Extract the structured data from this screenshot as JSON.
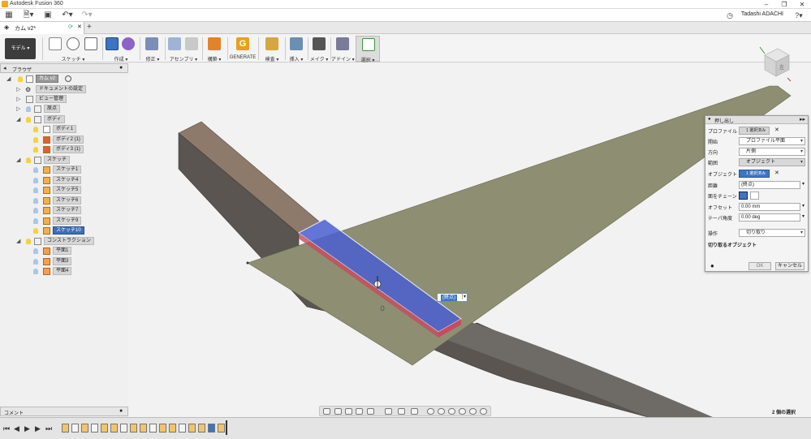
{
  "app": {
    "title": "Autodesk Fusion 360",
    "user": "Tadashi ADACHI"
  },
  "document_tab": {
    "label": "カム v2*"
  },
  "ribbon": {
    "workspace": "モデル ▾",
    "groups": [
      "スケッチ ▾",
      "作成 ▾",
      "修正 ▾",
      "アセンブリ ▾",
      "構築 ▾",
      "GENERATE",
      "検査 ▾",
      "挿入 ▾",
      "メイク ▾",
      "アドイン ▾",
      "選択 ▾"
    ]
  },
  "browser": {
    "header": "ブラウザ",
    "root": "カム v2",
    "nodes": [
      {
        "label": "ドキュメントの設定"
      },
      {
        "label": "ビュー管理"
      },
      {
        "label": "原点"
      },
      {
        "label": "ボディ"
      },
      {
        "label": "ボディ1"
      },
      {
        "label": "ボディ2 (1)"
      },
      {
        "label": "ボディ3 (1)"
      },
      {
        "label": "スケッチ"
      },
      {
        "label": "スケッチ1"
      },
      {
        "label": "スケッチ4"
      },
      {
        "label": "スケッチ5"
      },
      {
        "label": "スケッチ6"
      },
      {
        "label": "スケッチ7"
      },
      {
        "label": "スケッチ9"
      },
      {
        "label": "スケッチ10"
      },
      {
        "label": "コンストラクション"
      },
      {
        "label": "平面1"
      },
      {
        "label": "平面3"
      },
      {
        "label": "平面4"
      }
    ]
  },
  "comments": {
    "header": "コメント"
  },
  "dialog": {
    "title": "押し出し",
    "rows": [
      {
        "label": "プロファイル",
        "value": "1 選択済み"
      },
      {
        "label": "開始",
        "value": "プロファイル平面"
      },
      {
        "label": "方向",
        "value": "片側"
      },
      {
        "label": "範囲",
        "value": "オブジェクト"
      },
      {
        "label": "オブジェクト",
        "value": "1 選択済み"
      },
      {
        "label": "距離",
        "value": "(終点)"
      },
      {
        "label": "面をチェーン",
        "value": ""
      },
      {
        "label": "オフセット",
        "value": "0.00 mm"
      },
      {
        "label": "テーパ角度",
        "value": "0.00 deg"
      },
      {
        "label": "操作",
        "value": "切り取り"
      }
    ],
    "section": "切り取るオブジェクト",
    "ok": "OK",
    "cancel": "キャンセル"
  },
  "viewport": {
    "distance_field": "(終点)"
  },
  "status": {
    "selection": "2 個の選択"
  },
  "colors": {
    "accent": "#3d74c4",
    "surface": "#8c8c6c",
    "extrude": "#4a5fd0"
  }
}
